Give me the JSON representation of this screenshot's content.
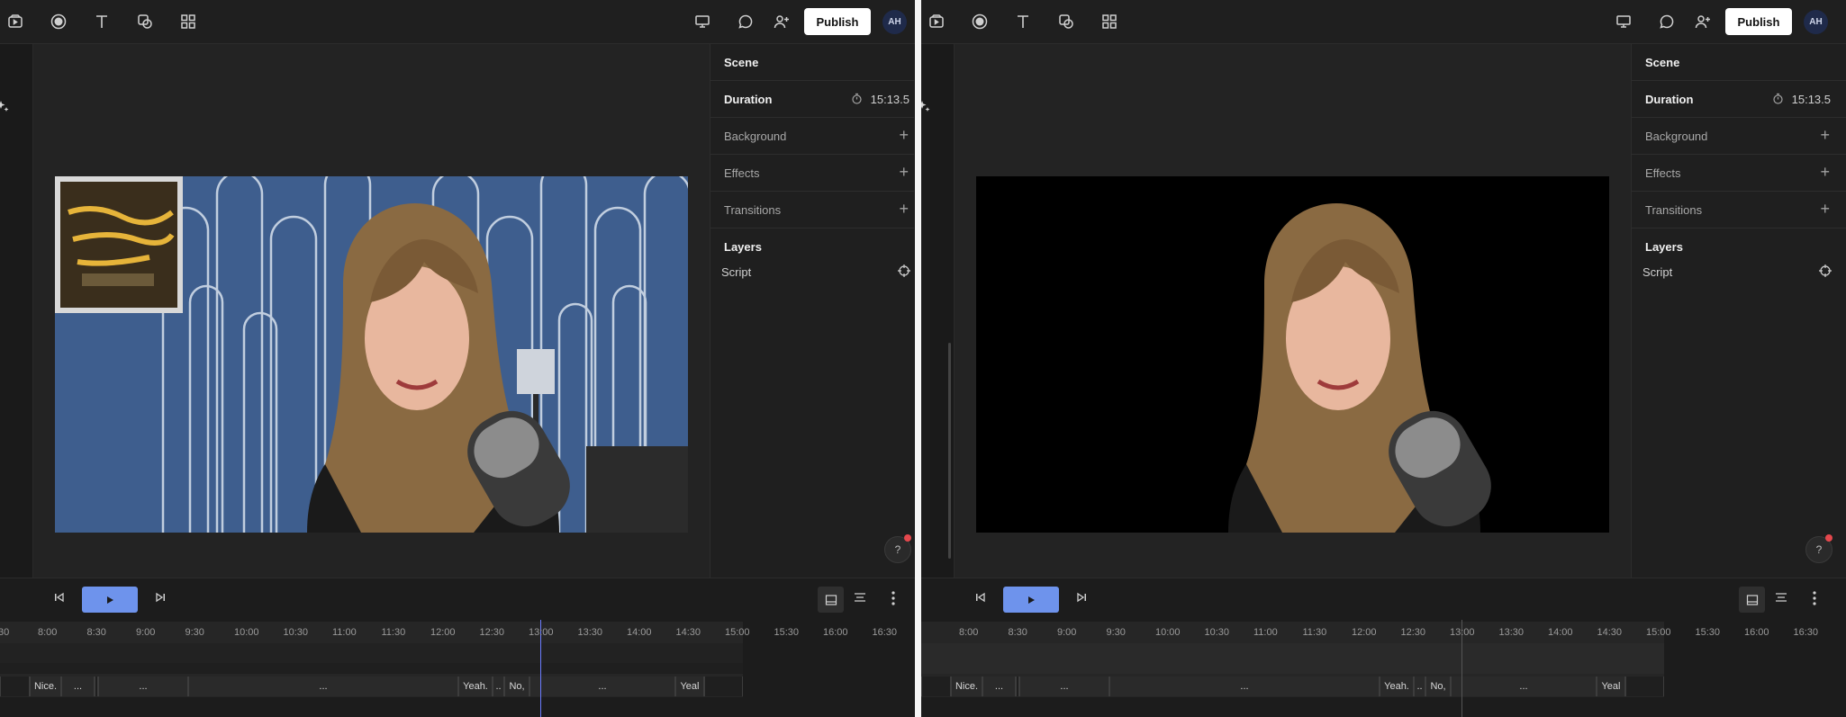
{
  "toolbar": {
    "publish_label": "Publish",
    "avatar_initials": "AH"
  },
  "panel": {
    "scene": "Scene",
    "duration_label": "Duration",
    "duration_value": "15:13.5",
    "background": "Background",
    "effects": "Effects",
    "transitions": "Transitions",
    "layers": "Layers",
    "script": "Script",
    "help": "?"
  },
  "timeline": {
    "ticks": [
      "8:00",
      "8:30",
      "9:00",
      "9:30",
      "10:00",
      "10:30",
      "11:00",
      "11:30",
      "12:00",
      "12:30",
      "13:00",
      "13:30",
      "14:00",
      "14:30",
      "15:00",
      "15:30",
      "16:00",
      "16:30"
    ],
    "partial_tick": "30",
    "captions": [
      "Nice.",
      "...",
      "...",
      "...",
      "Yeah.",
      "..",
      "No,",
      "...",
      "Yeal"
    ]
  },
  "colors": {
    "accent_play": "#6e93ec",
    "playhead_left": "#6b7cff",
    "publish_bg": "#ffffff",
    "help_dot": "#e5484d"
  }
}
